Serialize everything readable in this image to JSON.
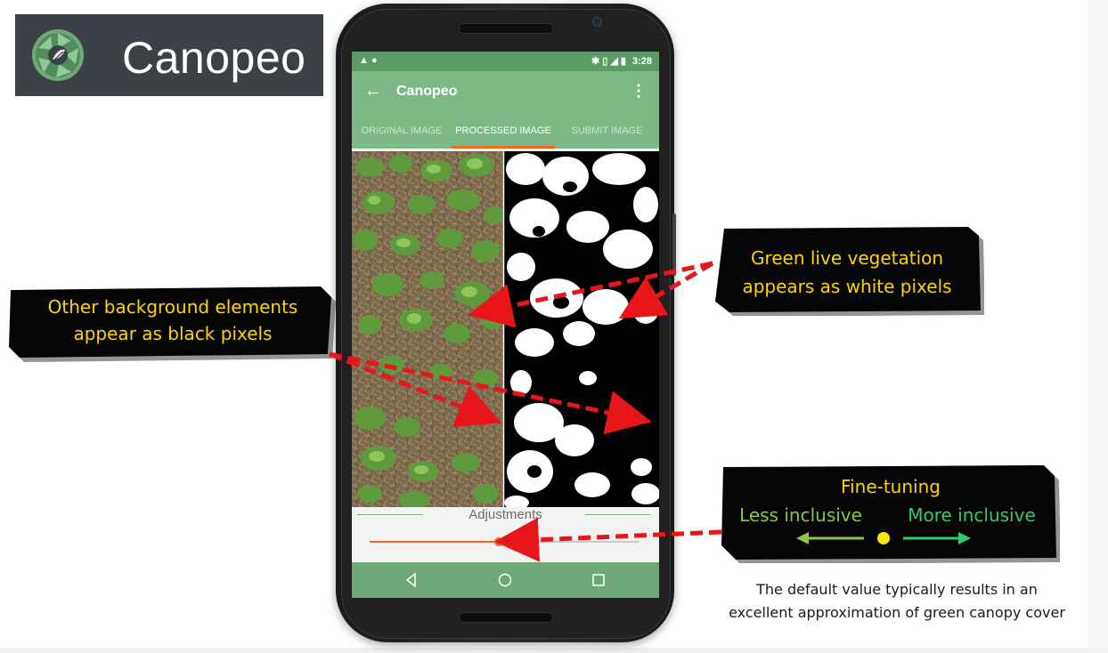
{
  "logo": {
    "text": "Canopeo",
    "icon": "camera-aperture-leaf-icon"
  },
  "phone": {
    "status_bar": {
      "left_icons": "▲ ●",
      "right_icons": "✱ ▯ ◢ ▮",
      "time": "3:28"
    },
    "app_bar": {
      "title": "Canopeo",
      "back_icon": "arrow-left-icon",
      "menu_icon": "more-vertical-icon"
    },
    "tabs": [
      {
        "label": "ORIGINAL IMAGE",
        "active": false
      },
      {
        "label": "PROCESSED IMAGE",
        "active": true
      },
      {
        "label": "SUBMIT IMAGE",
        "active": false
      }
    ],
    "adjustments": {
      "label": "Adjustments",
      "slider_value": 0.48
    },
    "nav": {
      "back_icon": "triangle-back-icon",
      "home_icon": "circle-home-icon",
      "recents_icon": "square-recents-icon"
    }
  },
  "callouts": {
    "right": [
      "Green live vegetation",
      "appears as white pixels"
    ],
    "left": [
      "Other background elements",
      "appear as black pixels"
    ],
    "fine_tuning": {
      "title": "Fine-tuning",
      "less": "Less inclusive",
      "more": "More inclusive"
    }
  },
  "caption": [
    "The default value typically results in an",
    "excellent approximation of green canopy cover"
  ],
  "colors": {
    "callout_text": "#ffd400",
    "app_green": "#7db887",
    "accent_orange": "#f26522",
    "arrow_red": "#e8151b"
  }
}
